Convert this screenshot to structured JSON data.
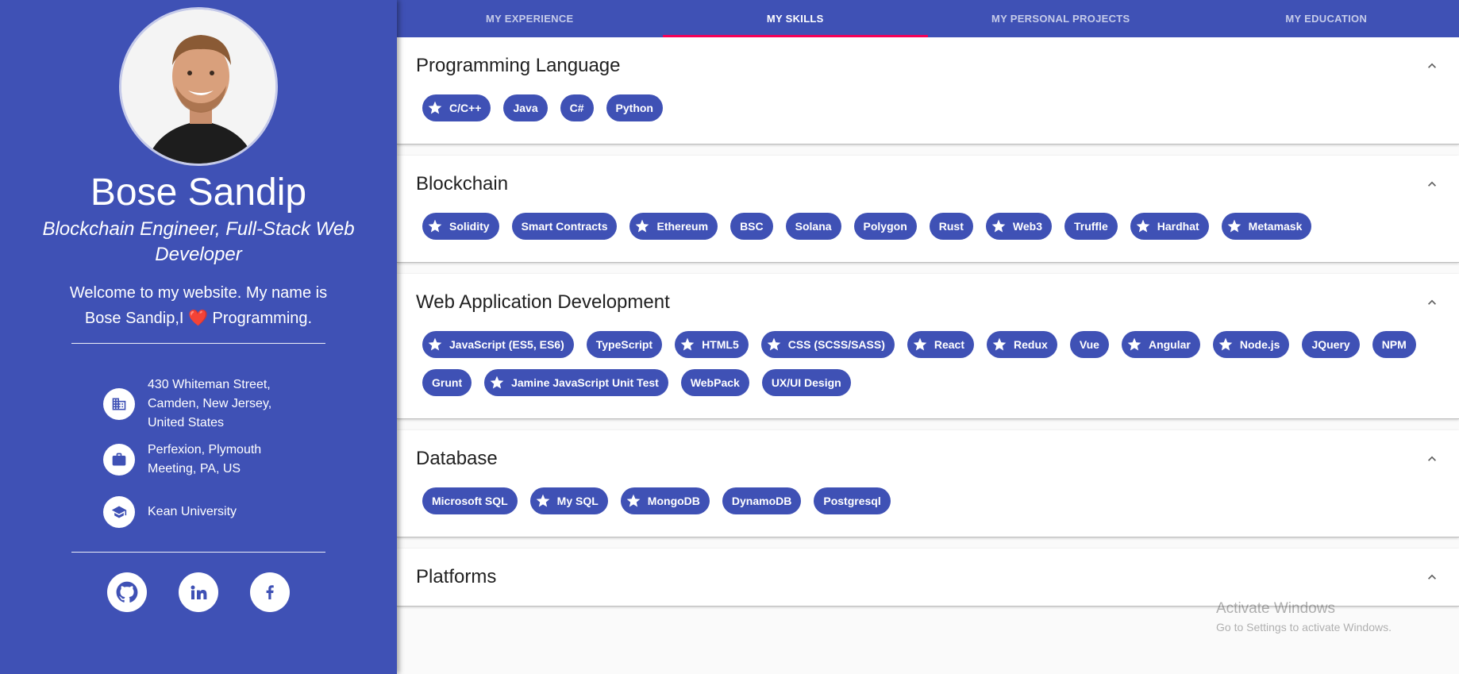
{
  "profile": {
    "name": "Bose Sandip",
    "role": "Blockchain Engineer, Full-Stack Web Developer",
    "welcome_pre": "Welcome to my website. My name is Bose Sandip,I ",
    "heart": "❤️",
    "welcome_post": " Programming.",
    "address": "430 Whiteman Street, Camden, New Jersey, United States",
    "company": "Perfexion, Plymouth Meeting, PA, US",
    "school": "Kean University",
    "icons": {
      "address": "building-icon",
      "company": "briefcase-icon",
      "school": "graduation-cap-icon"
    },
    "social": [
      "github-icon",
      "linkedin-icon",
      "facebook-icon"
    ]
  },
  "tabs": [
    {
      "label": "MY EXPERIENCE",
      "active": false
    },
    {
      "label": "MY SKILLS",
      "active": true
    },
    {
      "label": "MY PERSONAL PROJECTS",
      "active": false
    },
    {
      "label": "MY EDUCATION",
      "active": false
    }
  ],
  "sections": [
    {
      "title": "Programming Language",
      "chips": [
        {
          "label": "C/C++",
          "star": true
        },
        {
          "label": "Java",
          "star": false
        },
        {
          "label": "C#",
          "star": false
        },
        {
          "label": "Python",
          "star": false
        }
      ]
    },
    {
      "title": "Blockchain",
      "chips": [
        {
          "label": "Solidity",
          "star": true
        },
        {
          "label": "Smart Contracts",
          "star": false
        },
        {
          "label": "Ethereum",
          "star": true
        },
        {
          "label": "BSC",
          "star": false
        },
        {
          "label": "Solana",
          "star": false
        },
        {
          "label": "Polygon",
          "star": false
        },
        {
          "label": "Rust",
          "star": false
        },
        {
          "label": "Web3",
          "star": true
        },
        {
          "label": "Truffle",
          "star": false
        },
        {
          "label": "Hardhat",
          "star": true
        },
        {
          "label": "Metamask",
          "star": true
        }
      ]
    },
    {
      "title": "Web Application Development",
      "chips": [
        {
          "label": "JavaScript (ES5, ES6)",
          "star": true
        },
        {
          "label": "TypeScript",
          "star": false
        },
        {
          "label": "HTML5",
          "star": true
        },
        {
          "label": "CSS (SCSS/SASS)",
          "star": true
        },
        {
          "label": "React",
          "star": true
        },
        {
          "label": "Redux",
          "star": true
        },
        {
          "label": "Vue",
          "star": false
        },
        {
          "label": "Angular",
          "star": true
        },
        {
          "label": "Node.js",
          "star": true
        },
        {
          "label": "JQuery",
          "star": false
        },
        {
          "label": "NPM",
          "star": false
        },
        {
          "label": "Grunt",
          "star": false
        },
        {
          "label": "Jamine JavaScript Unit Test",
          "star": true
        },
        {
          "label": "WebPack",
          "star": false
        },
        {
          "label": "UX/UI Design",
          "star": false
        }
      ]
    },
    {
      "title": "Database",
      "chips": [
        {
          "label": "Microsoft SQL",
          "star": false
        },
        {
          "label": "My SQL",
          "star": true
        },
        {
          "label": "MongoDB",
          "star": true
        },
        {
          "label": "DynamoDB",
          "star": false
        },
        {
          "label": "Postgresql",
          "star": false
        }
      ]
    },
    {
      "title": "Platforms",
      "chips": []
    }
  ],
  "watermark": {
    "line1": "Activate Windows",
    "line2": "Go to Settings to activate Windows."
  },
  "colors": {
    "primary": "#3f51b5",
    "tab_indicator": "#f50057"
  }
}
